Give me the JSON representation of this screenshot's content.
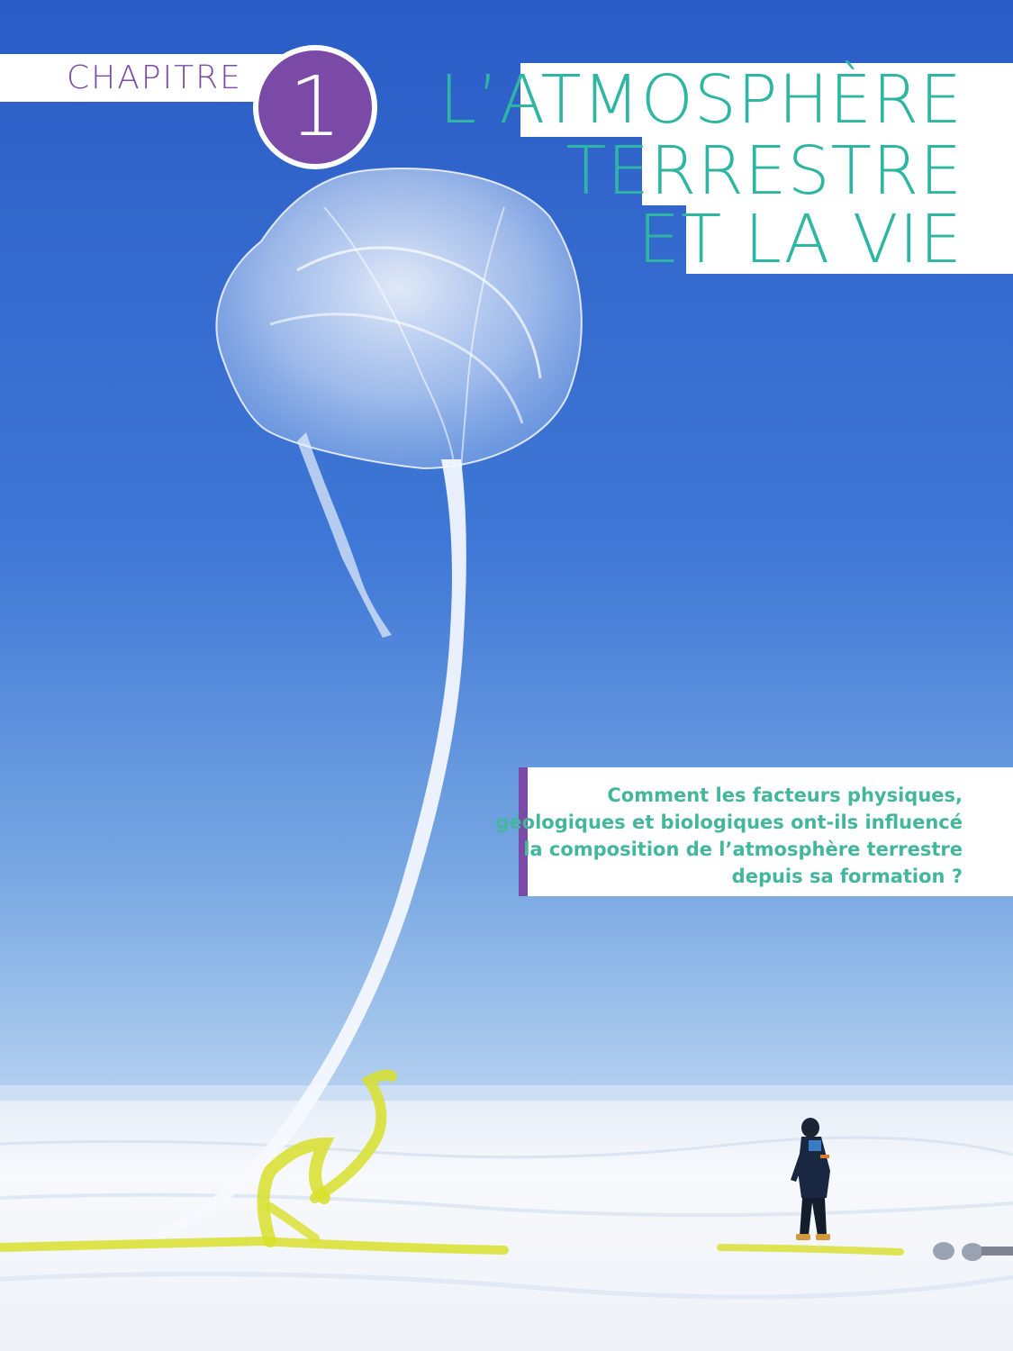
{
  "chapter": {
    "label": "CHAPITRE",
    "number": "1"
  },
  "title": {
    "lines": [
      "L’ATMOSPHÈRE",
      "TERRESTRE",
      "ET LA VIE"
    ]
  },
  "question": {
    "lines": [
      "Comment les facteurs physiques,",
      "géologiques et biologiques ont-ils influencé",
      "la composition de l’atmosphère terrestre",
      "depuis sa formation ?"
    ]
  },
  "colors": {
    "accent_purple": "#7b4aa6",
    "title_teal": "#2fb6a2",
    "question_teal": "#43b69c",
    "sky_top": "#2f63c9",
    "sky_bottom": "#8fb8e6",
    "snow": "#f4f7fb",
    "ribbon": "#d8df2a"
  }
}
